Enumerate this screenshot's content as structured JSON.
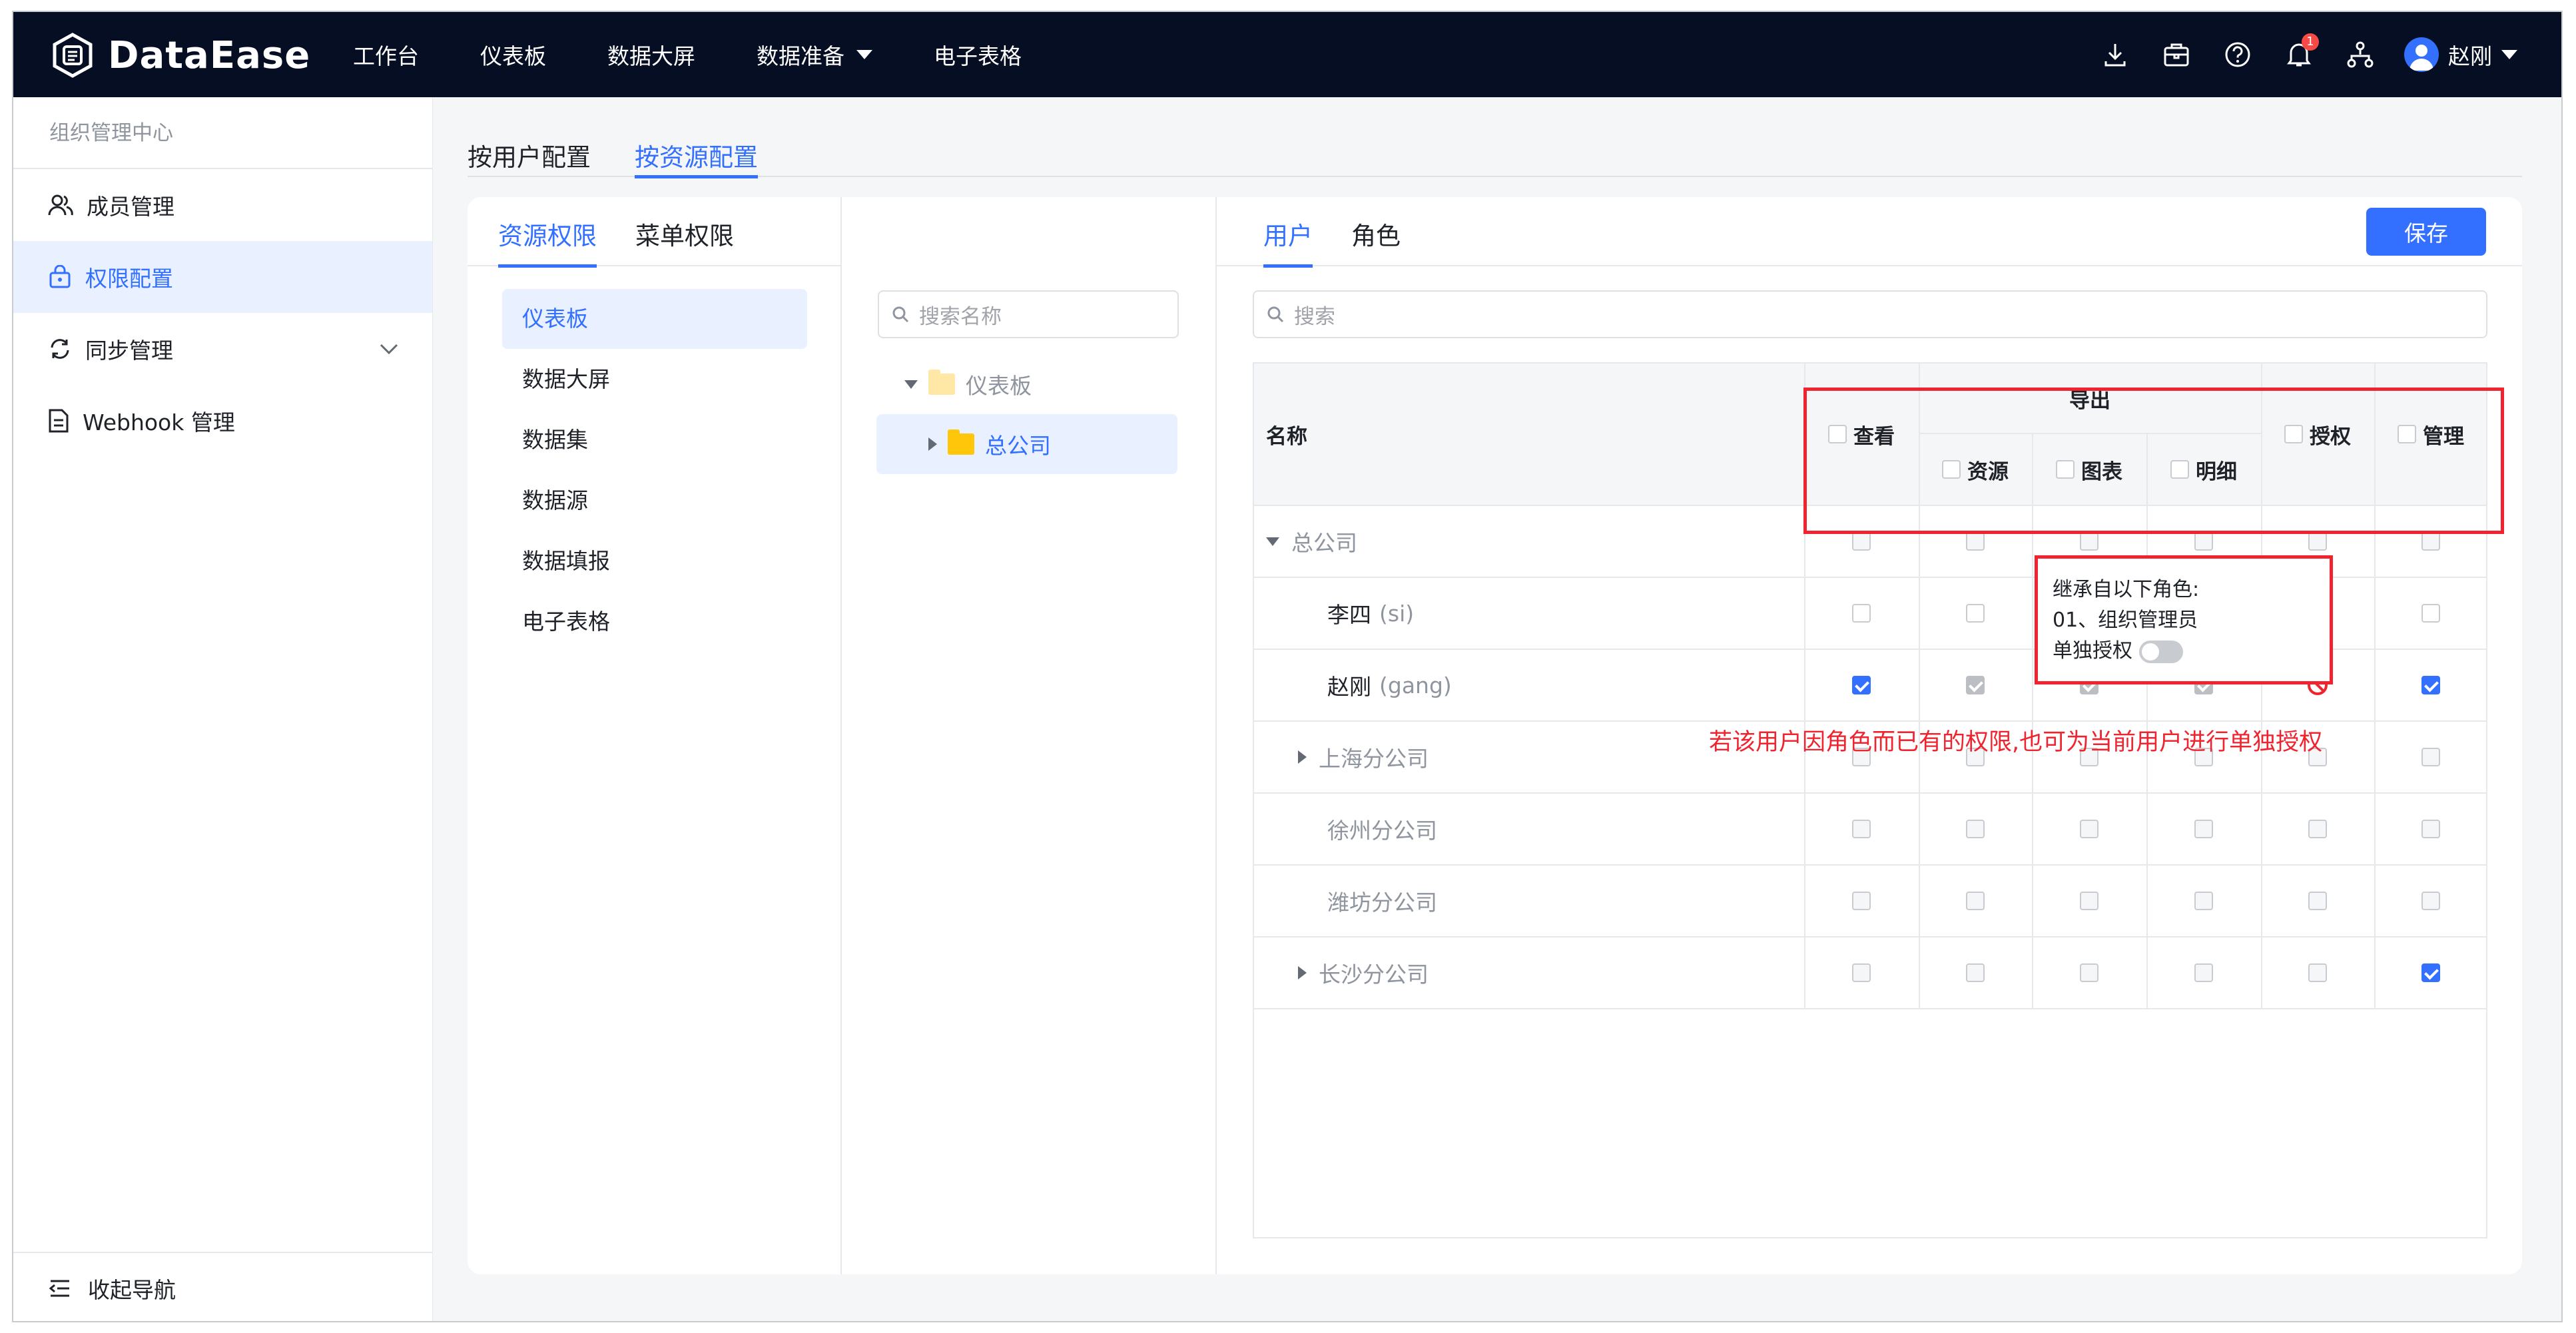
{
  "app": {
    "logo_text": "DataEase"
  },
  "nav": {
    "items": [
      "工作台",
      "仪表板",
      "数据大屏",
      "数据准备",
      "电子表格"
    ]
  },
  "header": {
    "notification_count": "1",
    "user_name": "赵刚"
  },
  "sidebar": {
    "title": "组织管理中心",
    "items": [
      {
        "label": "成员管理",
        "icon": "members-icon"
      },
      {
        "label": "权限配置",
        "icon": "lock-icon",
        "active": true
      },
      {
        "label": "同步管理",
        "icon": "sync-icon"
      },
      {
        "label": "Webhook 管理",
        "icon": "document-icon"
      }
    ],
    "collapse_label": "收起导航"
  },
  "main": {
    "tabs": [
      "按用户配置",
      "按资源配置"
    ],
    "active_tab": "按资源配置",
    "left_tabs": [
      "资源权限",
      "菜单权限"
    ],
    "resource_types": [
      "仪表板",
      "数据大屏",
      "数据集",
      "数据源",
      "数据填报",
      "电子表格"
    ],
    "tree_search_placeholder": "搜索名称",
    "tree": [
      {
        "label": "仪表板",
        "level": 0,
        "expanded": true
      },
      {
        "label": "总公司",
        "level": 1,
        "selected": true
      }
    ],
    "right_tabs": [
      "用户",
      "角色"
    ],
    "save_label": "保存",
    "search_placeholder": "搜索",
    "table": {
      "col_name": "名称",
      "col_view": "查看",
      "col_export": "导出",
      "col_export_resource": "资源",
      "col_export_chart": "图表",
      "col_export_detail": "明细",
      "col_grant": "授权",
      "col_manage": "管理",
      "rows": [
        {
          "name": "总公司",
          "sub": "",
          "level": 0,
          "expand": "down",
          "dim": true,
          "cells": [
            "d",
            "d",
            "d",
            "d",
            "d",
            "d"
          ]
        },
        {
          "name": "李四",
          "sub": "(si)",
          "level": 1,
          "expand": "",
          "dim": false,
          "cells": [
            "e",
            "e",
            "e",
            "e",
            "e",
            "e"
          ]
        },
        {
          "name": "赵刚",
          "sub": "(gang)",
          "level": 1,
          "expand": "",
          "dim": false,
          "cells": [
            "c",
            "g",
            "g",
            "g",
            "b",
            "c"
          ]
        },
        {
          "name": "上海分公司",
          "sub": "",
          "level": 1,
          "expand": "right",
          "dim": true,
          "cells": [
            "d",
            "d",
            "d",
            "d",
            "d",
            "d"
          ]
        },
        {
          "name": "徐州分公司",
          "sub": "",
          "level": 1,
          "expand": "",
          "dim": true,
          "cells": [
            "d",
            "d",
            "d",
            "d",
            "d",
            "d"
          ]
        },
        {
          "name": "潍坊分公司",
          "sub": "",
          "level": 1,
          "expand": "",
          "dim": true,
          "cells": [
            "d",
            "d",
            "d",
            "d",
            "d",
            "d"
          ]
        },
        {
          "name": "长沙分公司",
          "sub": "",
          "level": 1,
          "expand": "right",
          "dim": true,
          "cells": [
            "d",
            "d",
            "d",
            "d",
            "d",
            "c"
          ]
        }
      ]
    },
    "tooltip": {
      "line1": "继承自以下角色:",
      "line2": "01、组织管理员",
      "line3": "单独授权"
    },
    "annotation": "若该用户因角色而已有的权限,也可为当前用户进行单独授权"
  },
  "colors": {
    "primary": "#3370ff",
    "topbar": "#050e23",
    "annotation": "#f0242f"
  }
}
